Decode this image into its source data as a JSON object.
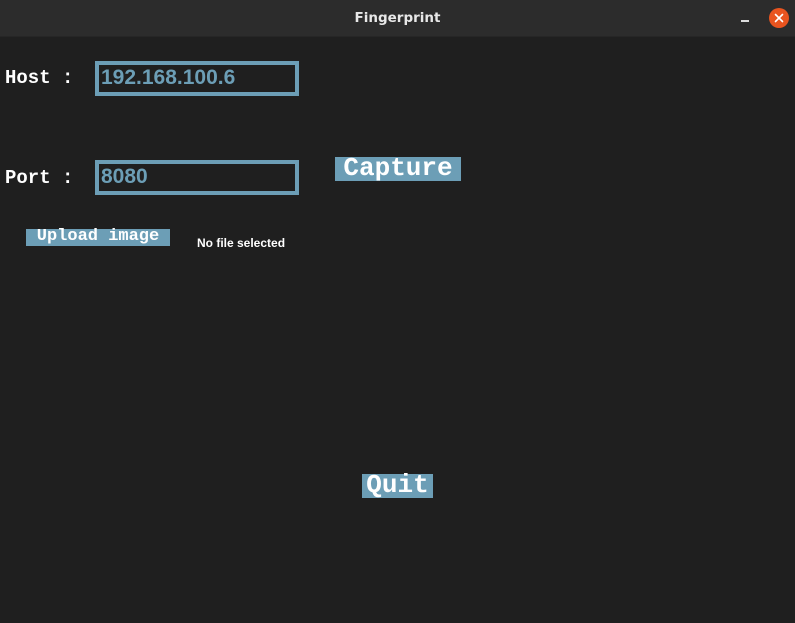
{
  "window": {
    "title": "Fingerprint",
    "minimize_icon": "minimize-icon",
    "close_icon": "close-icon",
    "close_color": "#e9541f"
  },
  "form": {
    "host_label": "Host :",
    "host_value": "192.168.100.6",
    "port_label": "Port :",
    "port_value": "8080"
  },
  "buttons": {
    "capture": "Capture",
    "upload": "Upload image",
    "quit": "Quit"
  },
  "upload_status": "No file selected",
  "colors": {
    "background": "#1f1f1f",
    "accent": "#6c9eb6",
    "text": "#ffffff"
  }
}
